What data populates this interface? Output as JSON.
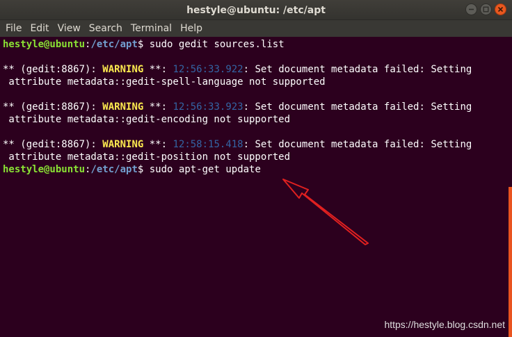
{
  "window": {
    "title": "hestyle@ubuntu: /etc/apt",
    "buttons": [
      "minimize",
      "maximize",
      "close"
    ]
  },
  "menu": [
    "File",
    "Edit",
    "View",
    "Search",
    "Terminal",
    "Help"
  ],
  "prompt": {
    "user_host": "hestyle@ubuntu",
    "colon": ":",
    "path": "/etc/apt",
    "dollar": "$"
  },
  "commands": [
    " sudo gedit sources.list",
    " sudo apt-get update"
  ],
  "warnings": [
    {
      "prefix": "** (gedit:8867): ",
      "level": "WARNING",
      "mid": " **: ",
      "time": "12:56:33.922",
      "msg": ": Set document metadata failed: Setting",
      "cont": " attribute metadata::gedit-spell-language not supported"
    },
    {
      "prefix": "** (gedit:8867): ",
      "level": "WARNING",
      "mid": " **: ",
      "time": "12:56:33.923",
      "msg": ": Set document metadata failed: Setting",
      "cont": " attribute metadata::gedit-encoding not supported"
    },
    {
      "prefix": "** (gedit:8867): ",
      "level": "WARNING",
      "mid": " **: ",
      "time": "12:58:15.418",
      "msg": ": Set document metadata failed: Setting",
      "cont": " attribute metadata::gedit-position not supported"
    }
  ],
  "watermark": "https://hestyle.blog.csdn.net",
  "colors": {
    "background": "#2c001e",
    "prompt_user": "#8ae234",
    "prompt_path": "#729fcf",
    "warning": "#fce94f",
    "timestamp": "#3465a4",
    "annotation_arrow": "#e02020",
    "scrollbar": "#e95420"
  }
}
